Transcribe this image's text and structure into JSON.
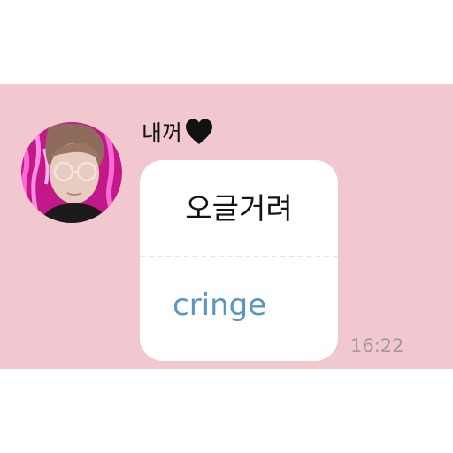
{
  "colors": {
    "chat_background": "#f1c8cf",
    "bubble_background": "#ffffff",
    "translation_text": "#5a96c0",
    "timestamp_text": "#a29a9c",
    "heart": "#111111"
  },
  "message": {
    "sender_name": "내꺼",
    "sender_icon": "black-heart-icon",
    "original_text": "오글거려",
    "translated_text": "cringe",
    "timestamp": "16:22"
  }
}
